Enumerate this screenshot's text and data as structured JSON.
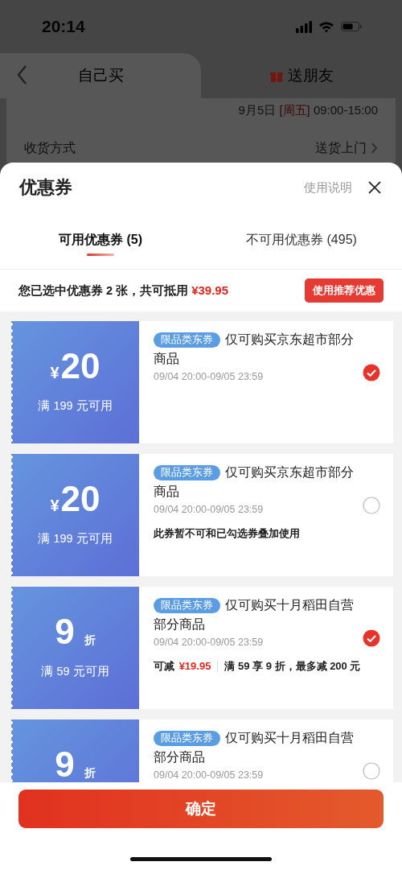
{
  "status_bar": {
    "time": "20:14"
  },
  "top_tabs": [
    {
      "label": "自己买",
      "selected": true,
      "kind": "plain"
    },
    {
      "label": "送朋友",
      "selected": false,
      "kind": "gift"
    }
  ],
  "delivery": {
    "date": "9月5日",
    "weekday": "[周五]",
    "hours": "09:00-15:00",
    "method_label": "收货方式",
    "method_value": "送货上门"
  },
  "sheet": {
    "title": "优惠券",
    "help_link": "使用说明",
    "tabs": [
      {
        "label": "可用优惠券 (5)",
        "selected": true
      },
      {
        "label": "不可用优惠券 (495)",
        "selected": false
      }
    ],
    "summary": {
      "text": "您已选中优惠券 2 张，共可抵用",
      "amount": "¥39.95",
      "button": "使用推荐优惠"
    },
    "coupons": [
      {
        "kind": "amount",
        "symbol": "¥",
        "value": "20",
        "condition": "满 199 元可用",
        "tag": "限品类东券",
        "title": "仅可购买京东超市部分商品",
        "validity": "09/04 20:00-09/05 23:59",
        "checked": true
      },
      {
        "kind": "amount",
        "symbol": "¥",
        "value": "20",
        "condition": "满 199 元可用",
        "tag": "限品类东券",
        "title": "仅可购买京东超市部分商品",
        "validity": "09/04 20:00-09/05 23:59",
        "note": "此券暂不可和已勾选券叠加使用",
        "checked": false
      },
      {
        "kind": "discount",
        "value": "9",
        "unit": "折",
        "condition": "满 59 元可用",
        "tag": "限品类东券",
        "title": "仅可购买十月稻田自营部分商品",
        "validity": "09/04 20:00-09/05 23:59",
        "saving_label": "可减",
        "saving": "¥19.95",
        "rule": "满 59 享 9 折，最多减 200 元",
        "checked": true
      },
      {
        "kind": "discount",
        "value": "9",
        "unit": "折",
        "tag": "限品类东券",
        "title": "仅可购买十月稻田自营部分商品",
        "validity": "09/04 20:00-09/05 23:59",
        "checked": false
      }
    ],
    "confirm_button": "确定"
  }
}
